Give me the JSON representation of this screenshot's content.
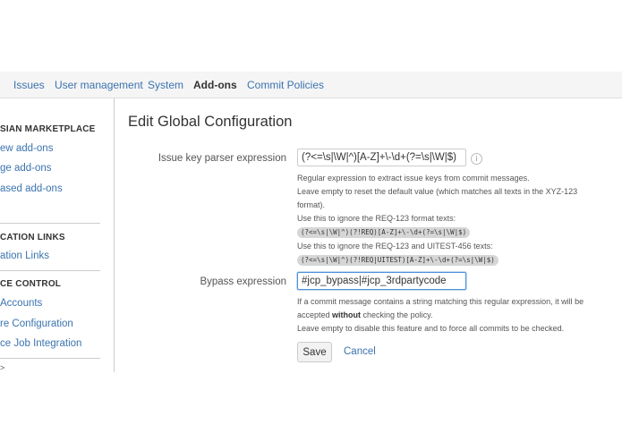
{
  "nav": {
    "tabs": [
      "Issues",
      "User management",
      "System",
      "Add-ons",
      "Commit Policies"
    ],
    "active_tab": "Add-ons"
  },
  "sidebar": {
    "marketplace_heading": "SIAN MARKETPLACE",
    "marketplace_links": [
      "ew add-ons",
      "ge add-ons",
      "ased add-ons"
    ],
    "links_heading": "CATION LINKS",
    "links_links": [
      "ation Links"
    ],
    "source_heading": "CE CONTROL",
    "source_links": [
      "Accounts",
      "re Configuration",
      "ce Job Integration"
    ],
    "trailing": ">"
  },
  "page": {
    "title": "Edit Global Configuration"
  },
  "issue_key": {
    "label": "Issue key parser expression",
    "value": "(?<=\\s|\\W|^)[A-Z]+\\-\\d+(?=\\s|\\W|$)",
    "info_icon": "info-icon",
    "help_1": "Regular expression to extract issue keys from commit messages.",
    "help_2": "Leave empty to reset the default value (which matches all texts in the XYZ-123",
    "help_3": "format).",
    "help_4": "Use this to ignore the REQ-123 format texts:",
    "code_1": "(?<=\\s|\\W|^)(?!REQ)[A-Z]+\\-\\d+(?=\\s|\\W|$)",
    "help_5": "Use this to ignore the REQ-123 and UITEST-456 texts:",
    "code_2": "(?<=\\s|\\W|^)(?!REQ|UITEST)[A-Z]+\\-\\d+(?=\\s|\\W|$)"
  },
  "bypass": {
    "label": "Bypass expression",
    "value": "#jcp_bypass|#jcp_3rdpartycode",
    "help_1a": "If a commit message contains a string matching this regular expression, it will be",
    "help_2a": "accepted ",
    "help_2b": "without",
    "help_2c": " checking the policy.",
    "help_3": "Leave empty to disable this feature and to force all commits to be checked."
  },
  "actions": {
    "save_label": "Save",
    "cancel_label": "Cancel"
  }
}
